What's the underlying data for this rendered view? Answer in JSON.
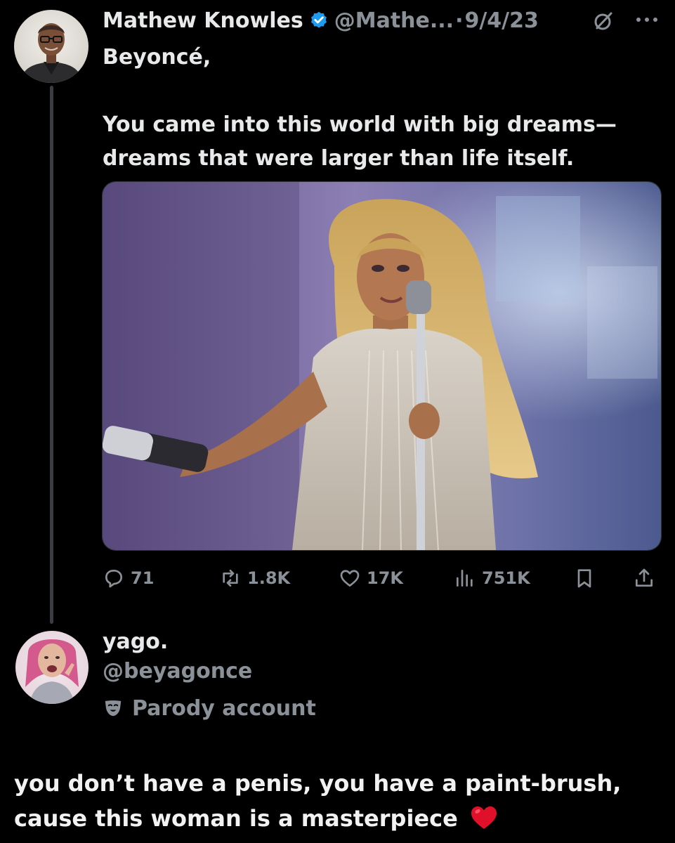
{
  "tweet": {
    "author": {
      "display_name": "Mathew Knowles",
      "handle": "@Mathe...",
      "verified": true,
      "avatar": "profile-photo-man-glasses"
    },
    "separator": "·",
    "date": "9/4/23",
    "text": "Beyoncé,\n\nYou came into this world with big dreams—\ndreams that were larger than life itself.",
    "media": "photo-performer-on-stage-with-microphone",
    "actions": {
      "replies": "71",
      "reposts": "1.8K",
      "likes": "17K",
      "views": "751K"
    },
    "icons": [
      "grok-icon",
      "more-icon",
      "reply-icon",
      "repost-icon",
      "like-icon",
      "views-icon",
      "bookmark-icon",
      "share-icon"
    ]
  },
  "reply": {
    "display_name": "yago.",
    "handle": "@beyagonce",
    "badge_label": "Parody account",
    "badge_icon": "theater-mask-icon",
    "avatar": "profile-photo-pink-hair"
  },
  "caption": {
    "text": "you don’t have a penis, you have a paint-brush, cause this woman is a masterpiece",
    "emoji": "red-heart"
  },
  "colors": {
    "background": "#000000",
    "primary_text": "#e7e9ea",
    "secondary_text": "#8b9198",
    "verified_blue": "#1d9bf0",
    "thread_line": "#3a3d41",
    "heart_red": "#e0102b"
  }
}
